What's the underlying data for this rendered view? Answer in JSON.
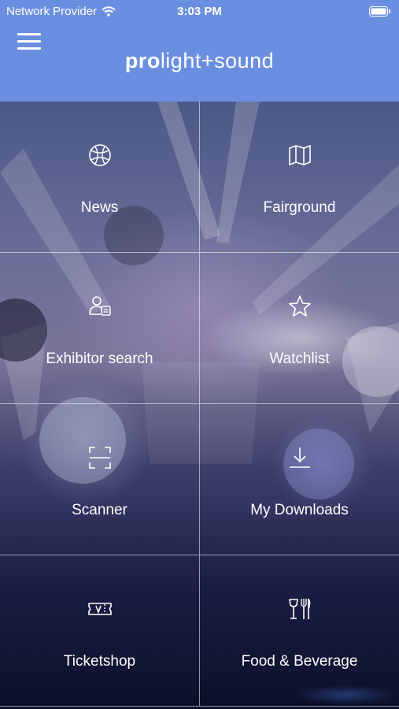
{
  "status_bar": {
    "carrier": "Network Provider",
    "time": "3:03 PM"
  },
  "header": {
    "logo_bold": "pro",
    "logo_light": "light+sound"
  },
  "tiles": [
    {
      "label": "News",
      "icon": "globe-icon"
    },
    {
      "label": "Fairground",
      "icon": "map-icon"
    },
    {
      "label": "Exhibitor search",
      "icon": "exhibitor-search-icon"
    },
    {
      "label": "Watchlist",
      "icon": "star-icon"
    },
    {
      "label": "Scanner",
      "icon": "scanner-icon"
    },
    {
      "label": "My Downloads",
      "icon": "download-icon"
    },
    {
      "label": "Ticketshop",
      "icon": "ticket-icon"
    },
    {
      "label": "Food & Beverage",
      "icon": "food-beverage-icon"
    }
  ],
  "colors": {
    "header_bg": "#6b8fe0",
    "text": "#ffffff"
  }
}
